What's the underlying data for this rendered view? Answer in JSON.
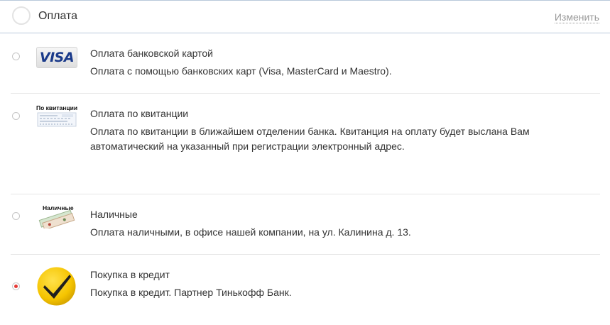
{
  "header": {
    "title": "Оплата",
    "change_link": "Изменить"
  },
  "options": [
    {
      "title": "Оплата банковской картой",
      "description": "Оплата с помощью банковских карт (Visa, MasterCard и Maestro).",
      "logo_text": "VISA",
      "selected": false
    },
    {
      "title": "Оплата по квитанции",
      "description": "Оплата по квитанции в ближайшем отделении банка. Квитанция на оплату будет выслана Вам автоматический на указанный при регистрации электронный адрес.",
      "logo_text": "По квитанции",
      "selected": false
    },
    {
      "title": "Наличные",
      "description": "Оплата наличными, в офисе нашей компании, на ул. Калинина д. 13.",
      "logo_text": "Наличные",
      "selected": false
    },
    {
      "title": "Покупка в кредит",
      "description": "Покупка в кредит. Партнер Тинькофф Банк.",
      "logo_icon": "tinkoff-checkmark-icon",
      "selected": true
    }
  ],
  "colors": {
    "border_blue": "#b9c9db",
    "selected_dot": "#e53935",
    "tinkoff_yellow": "#f5c400"
  }
}
